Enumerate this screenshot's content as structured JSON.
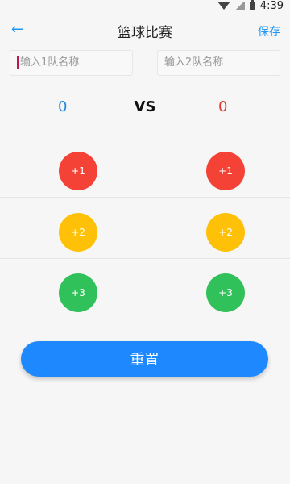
{
  "statusbar": {
    "time": "4:39"
  },
  "topbar": {
    "back_icon": "←",
    "title": "篮球比赛",
    "save_label": "保存"
  },
  "inputs": {
    "team1_placeholder": "输入1队名称",
    "team2_placeholder": "输入2队名称"
  },
  "scores": {
    "team1": "0",
    "vs": "VS",
    "team2": "0"
  },
  "buttons": {
    "plus1": "+1",
    "plus2": "+2",
    "plus3": "+3"
  },
  "reset_label": "重置"
}
